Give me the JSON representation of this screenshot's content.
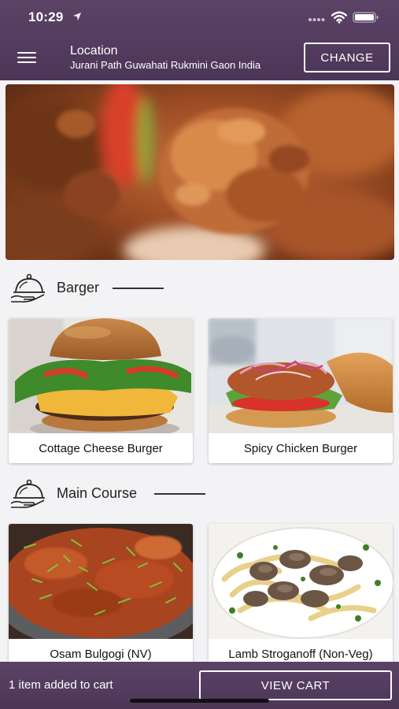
{
  "status_bar": {
    "time": "10:29"
  },
  "header": {
    "location_title": "Location",
    "location_address": "Jurani Path Guwahati Rukmini Gaon India",
    "change_label": "CHANGE"
  },
  "sections": [
    {
      "title": "Barger",
      "items": [
        {
          "name": "Cottage Cheese Burger"
        },
        {
          "name": "Spicy Chicken Burger"
        }
      ]
    },
    {
      "title": "Main Course",
      "items": [
        {
          "name": "Osam Bulgogi (NV)"
        },
        {
          "name": "Lamb Stroganoff (Non-Veg)"
        }
      ]
    }
  ],
  "cart": {
    "status": "1 item added to cart",
    "view_cart_label": "VIEW CART"
  },
  "icons": {
    "menu": "hamburger-menu-icon",
    "section": "food-cloche-icon",
    "location_arrow": "location-arrow-icon",
    "wifi": "wifi-icon",
    "battery": "battery-icon"
  },
  "colors": {
    "header_bg": "#4f3a5c",
    "page_bg": "#f3f3f5"
  }
}
